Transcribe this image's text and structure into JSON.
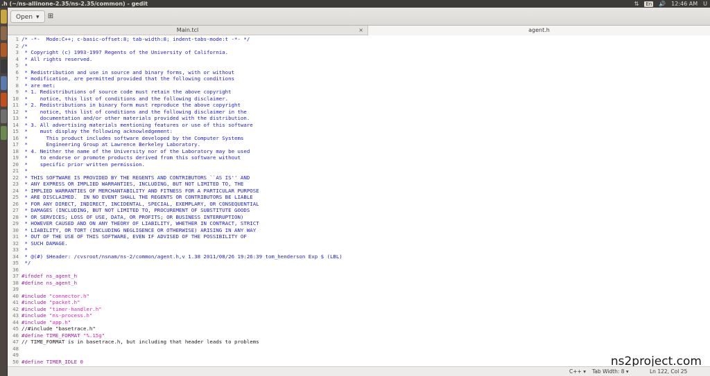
{
  "top_panel": {
    "window_title": ".h (~/ns-allinone-2.35/ns-2.35/common) - gedit",
    "keyboard_layout": "En",
    "time": "12:46 AM",
    "user": "U"
  },
  "launcher": {
    "icons": [
      {
        "name": "dash-icon",
        "color": "#c8a640"
      },
      {
        "name": "files-icon",
        "color": "#8a6a4a"
      },
      {
        "name": "browser-icon",
        "color": "#b05a2a"
      },
      {
        "name": "terminal-icon",
        "color": "#3a3a3a"
      },
      {
        "name": "libreoffice-icon",
        "color": "#5a7ab0"
      },
      {
        "name": "software-icon",
        "color": "#c05020"
      },
      {
        "name": "settings-icon",
        "color": "#707070"
      },
      {
        "name": "gedit-icon",
        "color": "#6a8a50"
      }
    ]
  },
  "headerbar": {
    "open_label": "Open",
    "open_arrow": "▾",
    "new_doc_icon": "⊞"
  },
  "tabs": [
    {
      "label": "Main.tcl",
      "active": false,
      "close": "×"
    },
    {
      "label": "agent.h",
      "active": true
    }
  ],
  "lines": [
    {
      "n": "1",
      "text": "/* -*-  Mode:C++; c-basic-offset:8; tab-width:8; indent-tabs-mode:t -*- */",
      "kind": "comment"
    },
    {
      "n": "2",
      "text": "/*",
      "kind": "comment"
    },
    {
      "n": "3",
      "text": " * Copyright (c) 1993-1997 Regents of the University of California.",
      "kind": "comment"
    },
    {
      "n": "4",
      "text": " * All rights reserved.",
      "kind": "comment"
    },
    {
      "n": "5",
      "text": " *",
      "kind": "comment"
    },
    {
      "n": "6",
      "text": " * Redistribution and use in source and binary forms, with or without",
      "kind": "comment"
    },
    {
      "n": "7",
      "text": " * modification, are permitted provided that the following conditions",
      "kind": "comment"
    },
    {
      "n": "8",
      "text": " * are met:",
      "kind": "comment"
    },
    {
      "n": "9",
      "text": " * 1. Redistributions of source code must retain the above copyright",
      "kind": "comment"
    },
    {
      "n": "10",
      "text": " *    notice, this list of conditions and the following disclaimer.",
      "kind": "comment"
    },
    {
      "n": "11",
      "text": " * 2. Redistributions in binary form must reproduce the above copyright",
      "kind": "comment"
    },
    {
      "n": "12",
      "text": " *    notice, this list of conditions and the following disclaimer in the",
      "kind": "comment"
    },
    {
      "n": "13",
      "text": " *    documentation and/or other materials provided with the distribution.",
      "kind": "comment"
    },
    {
      "n": "14",
      "text": " * 3. All advertising materials mentioning features or use of this software",
      "kind": "comment"
    },
    {
      "n": "15",
      "text": " *    must display the following acknowledgement:",
      "kind": "comment"
    },
    {
      "n": "16",
      "text": " *      This product includes software developed by the Computer Systems",
      "kind": "comment"
    },
    {
      "n": "17",
      "text": " *      Engineering Group at Lawrence Berkeley Laboratory.",
      "kind": "comment"
    },
    {
      "n": "18",
      "text": " * 4. Neither the name of the University nor of the Laboratory may be used",
      "kind": "comment"
    },
    {
      "n": "19",
      "text": " *    to endorse or promote products derived from this software without",
      "kind": "comment"
    },
    {
      "n": "20",
      "text": " *    specific prior written permission.",
      "kind": "comment"
    },
    {
      "n": "21",
      "text": " *",
      "kind": "comment"
    },
    {
      "n": "22",
      "text": " * THIS SOFTWARE IS PROVIDED BY THE REGENTS AND CONTRIBUTORS ``AS IS'' AND",
      "kind": "comment"
    },
    {
      "n": "23",
      "text": " * ANY EXPRESS OR IMPLIED WARRANTIES, INCLUDING, BUT NOT LIMITED TO, THE",
      "kind": "comment"
    },
    {
      "n": "24",
      "text": " * IMPLIED WARRANTIES OF MERCHANTABILITY AND FITNESS FOR A PARTICULAR PURPOSE",
      "kind": "comment"
    },
    {
      "n": "25",
      "text": " * ARE DISCLAIMED.  IN NO EVENT SHALL THE REGENTS OR CONTRIBUTORS BE LIABLE",
      "kind": "comment"
    },
    {
      "n": "26",
      "text": " * FOR ANY DIRECT, INDIRECT, INCIDENTAL, SPECIAL, EXEMPLARY, OR CONSEQUENTIAL",
      "kind": "comment"
    },
    {
      "n": "27",
      "text": " * DAMAGES (INCLUDING, BUT NOT LIMITED TO, PROCUREMENT OF SUBSTITUTE GOODS",
      "kind": "comment"
    },
    {
      "n": "28",
      "text": " * OR SERVICES; LOSS OF USE, DATA, OR PROFITS; OR BUSINESS INTERRUPTION)",
      "kind": "comment"
    },
    {
      "n": "29",
      "text": " * HOWEVER CAUSED AND ON ANY THEORY OF LIABILITY, WHETHER IN CONTRACT, STRICT",
      "kind": "comment"
    },
    {
      "n": "30",
      "text": " * LIABILITY, OR TORT (INCLUDING NEGLIGENCE OR OTHERWISE) ARISING IN ANY WAY",
      "kind": "comment"
    },
    {
      "n": "31",
      "text": " * OUT OF THE USE OF THIS SOFTWARE, EVEN IF ADVISED OF THE POSSIBILITY OF",
      "kind": "comment"
    },
    {
      "n": "32",
      "text": " * SUCH DAMAGE.",
      "kind": "comment"
    },
    {
      "n": "33",
      "text": " *",
      "kind": "comment"
    },
    {
      "n": "34",
      "text": " * @(#) $Header: /cvsroot/nsnam/ns-2/common/agent.h,v 1.38 2011/08/26 19:26:39 tom_henderson Exp $ (LBL)",
      "kind": "comment"
    },
    {
      "n": "35",
      "text": " */",
      "kind": "comment"
    },
    {
      "n": "36",
      "text": "",
      "kind": "plain"
    },
    {
      "n": "37",
      "text": "#ifndef ns_agent_h",
      "kind": "pp"
    },
    {
      "n": "38",
      "text": "#define ns_agent_h",
      "kind": "pp"
    },
    {
      "n": "39",
      "text": "",
      "kind": "plain"
    },
    {
      "n": "40",
      "pp": "#include ",
      "str": "\"connector.h\"",
      "kind": "include"
    },
    {
      "n": "41",
      "pp": "#include ",
      "str": "\"packet.h\"",
      "kind": "include"
    },
    {
      "n": "42",
      "pp": "#include ",
      "str": "\"timer-handler.h\"",
      "kind": "include"
    },
    {
      "n": "43",
      "pp": "#include ",
      "str": "\"ns-process.h\"",
      "kind": "include"
    },
    {
      "n": "44",
      "pp": "#include ",
      "str": "\"app.h\"",
      "kind": "include"
    },
    {
      "n": "45",
      "text": "//#include \"basetrace.h\"",
      "kind": "plain"
    },
    {
      "n": "46",
      "pp": "#define TIME_FORMAT ",
      "str": "\"%.15g\"",
      "kind": "include"
    },
    {
      "n": "47",
      "text": "// TIME_FORMAT is in basetrace.h, but including that header leads to problems",
      "kind": "plain"
    },
    {
      "n": "48",
      "text": "",
      "kind": "plain"
    },
    {
      "n": "49",
      "text": "",
      "kind": "plain"
    },
    {
      "n": "50",
      "text": "#define TIMER_IDLE 0",
      "kind": "pp"
    }
  ],
  "watermark": "ns2project.com",
  "status": {
    "language": "C++ ▾",
    "tab_width": "Tab Width: 8 ▾",
    "position": "Ln 122, Col 25"
  }
}
